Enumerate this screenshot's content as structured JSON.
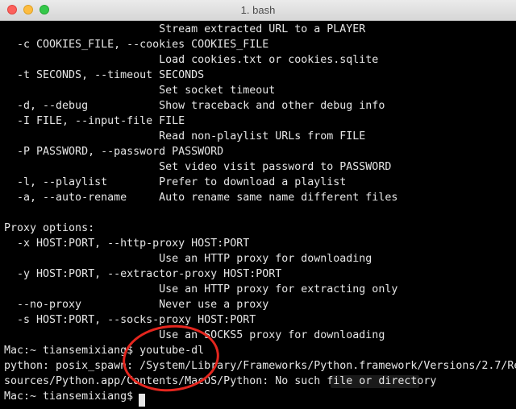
{
  "window": {
    "title": "1. bash",
    "colors": {
      "close": "#fc605c",
      "minimize": "#fdbc40",
      "maximize": "#34c84a",
      "annotation": "#e4261e"
    }
  },
  "terminal": {
    "lines": [
      "                        Stream extracted URL to a PLAYER",
      "  -c COOKIES_FILE, --cookies COOKIES_FILE",
      "                        Load cookies.txt or cookies.sqlite",
      "  -t SECONDS, --timeout SECONDS",
      "                        Set socket timeout",
      "  -d, --debug           Show traceback and other debug info",
      "  -I FILE, --input-file FILE",
      "                        Read non-playlist URLs from FILE",
      "  -P PASSWORD, --password PASSWORD",
      "                        Set video visit password to PASSWORD",
      "  -l, --playlist        Prefer to download a playlist",
      "  -a, --auto-rename     Auto rename same name different files",
      "",
      "Proxy options:",
      "  -x HOST:PORT, --http-proxy HOST:PORT",
      "                        Use an HTTP proxy for downloading",
      "  -y HOST:PORT, --extractor-proxy HOST:PORT",
      "                        Use an HTTP proxy for extracting only",
      "  --no-proxy            Never use a proxy",
      "  -s HOST:PORT, --socks-proxy HOST:PORT",
      "                        Use an SOCKS5 proxy for downloading",
      "Mac:~ tiansemixiang$ youtube-dl",
      "python: posix_spawn: /System/Library/Frameworks/Python.framework/Versions/2.7/Re",
      "sources/Python.app/Contents/MacOS/Python: No such file or directory",
      "Mac:~ tiansemixiang$ "
    ]
  }
}
